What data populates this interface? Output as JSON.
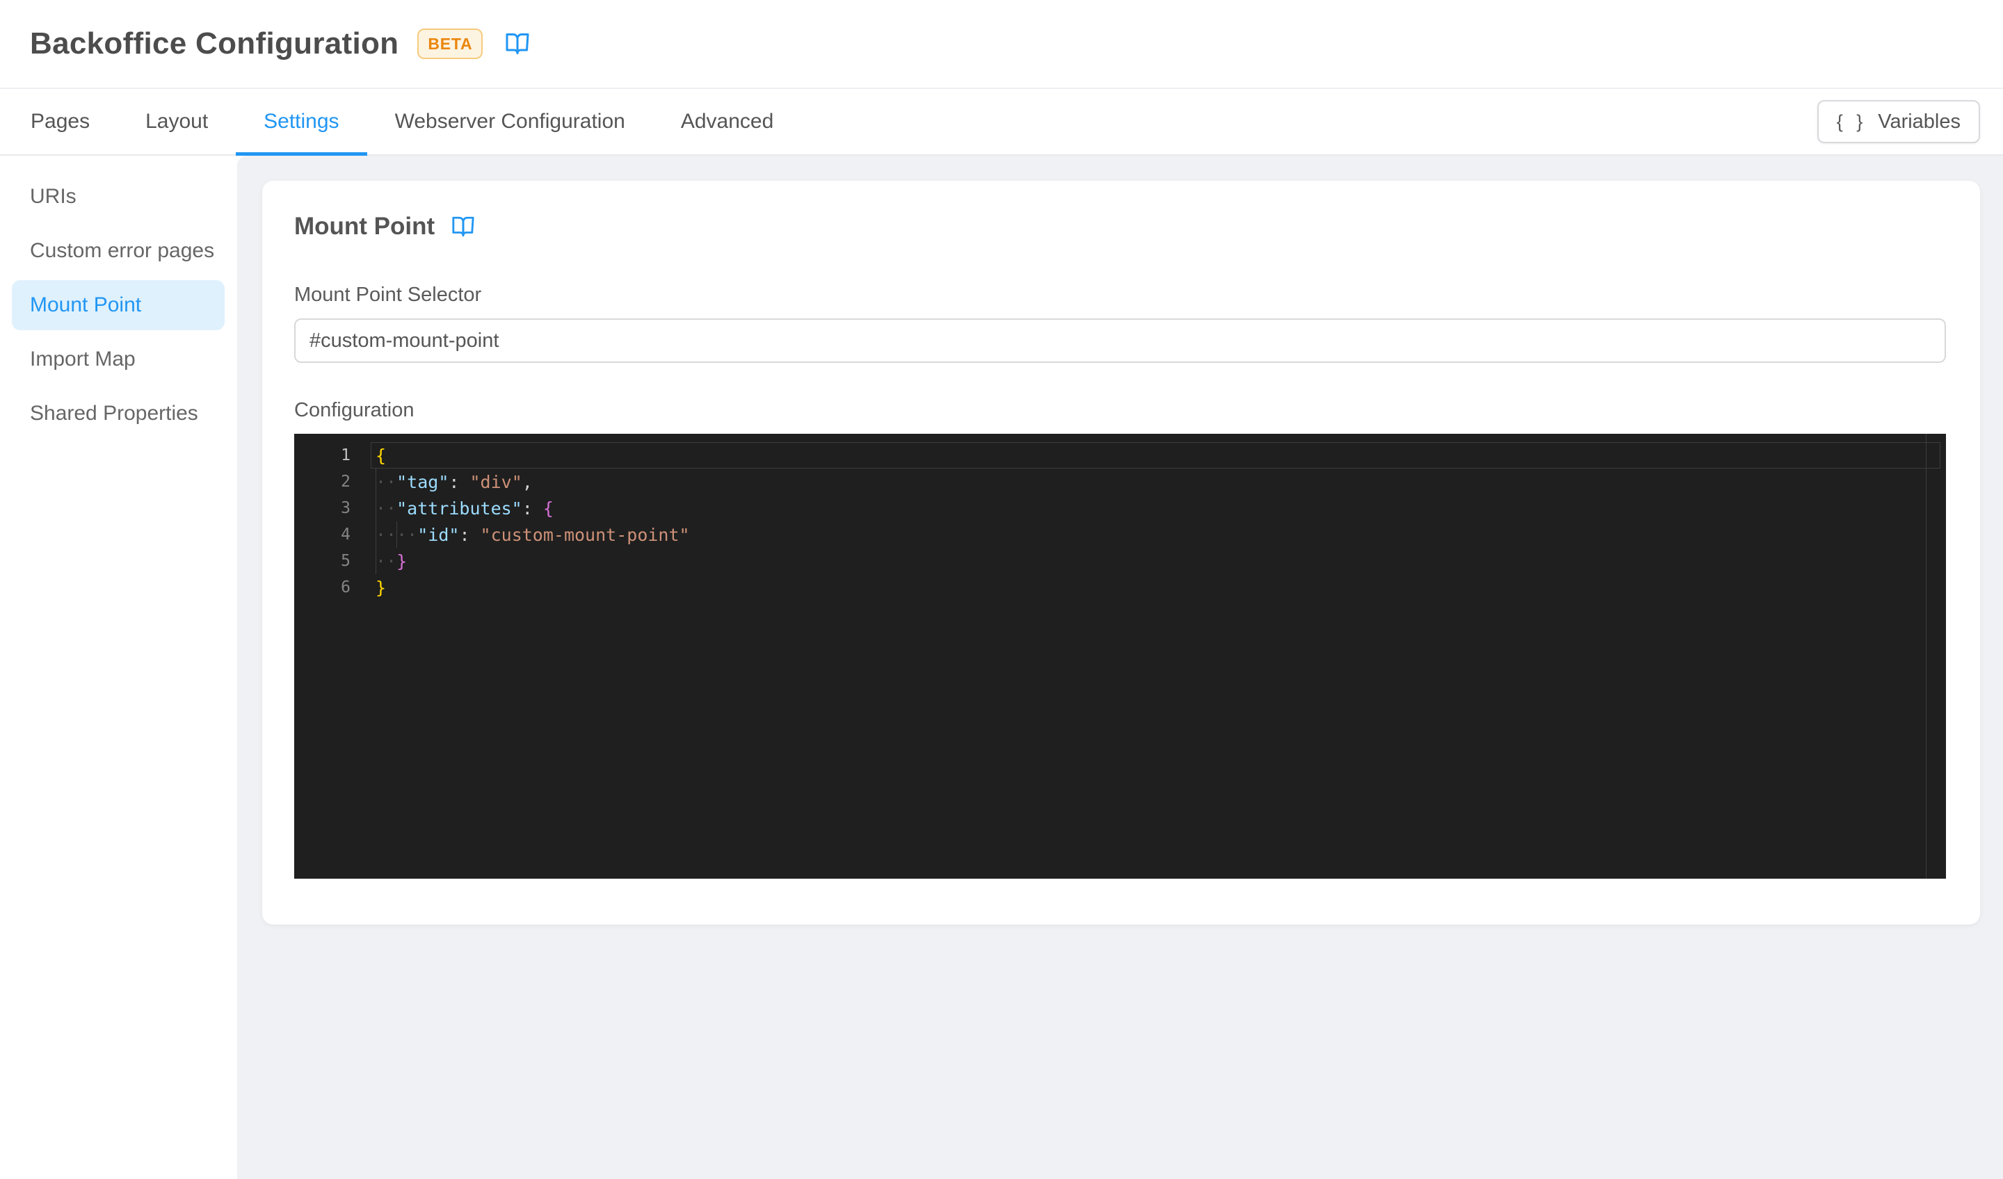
{
  "header": {
    "title": "Backoffice Configuration",
    "badge": "BETA"
  },
  "tabbar": {
    "tabs": [
      {
        "label": "Pages",
        "active": false
      },
      {
        "label": "Layout",
        "active": false
      },
      {
        "label": "Settings",
        "active": true
      },
      {
        "label": "Webserver Configuration",
        "active": false
      },
      {
        "label": "Advanced",
        "active": false
      }
    ],
    "variables_button": {
      "braces": "{ }",
      "label": "Variables"
    }
  },
  "sidebar": {
    "items": [
      {
        "label": "URIs",
        "active": false
      },
      {
        "label": "Custom error pages",
        "active": false
      },
      {
        "label": "Mount Point",
        "active": true
      },
      {
        "label": "Import Map",
        "active": false
      },
      {
        "label": "Shared Properties",
        "active": false
      }
    ]
  },
  "content": {
    "section_title": "Mount Point",
    "selector_field": {
      "label": "Mount Point Selector",
      "value": "#custom-mount-point"
    },
    "configuration": {
      "label": "Configuration",
      "code_lines": [
        {
          "number": "1",
          "current": true,
          "tokens": [
            {
              "type": "bracket1",
              "text": "{"
            }
          ]
        },
        {
          "number": "2",
          "current": false,
          "tokens": [
            {
              "type": "whitespace",
              "text": "··"
            },
            {
              "type": "key",
              "text": "\"tag\""
            },
            {
              "type": "punct",
              "text": ": "
            },
            {
              "type": "string",
              "text": "\"div\""
            },
            {
              "type": "punct",
              "text": ","
            }
          ]
        },
        {
          "number": "3",
          "current": false,
          "tokens": [
            {
              "type": "whitespace",
              "text": "··"
            },
            {
              "type": "key",
              "text": "\"attributes\""
            },
            {
              "type": "punct",
              "text": ": "
            },
            {
              "type": "bracket2",
              "text": "{"
            }
          ]
        },
        {
          "number": "4",
          "current": false,
          "tokens": [
            {
              "type": "whitespace",
              "text": "····"
            },
            {
              "type": "key",
              "text": "\"id\""
            },
            {
              "type": "punct",
              "text": ": "
            },
            {
              "type": "string",
              "text": "\"custom-mount-point\""
            }
          ]
        },
        {
          "number": "5",
          "current": false,
          "tokens": [
            {
              "type": "whitespace",
              "text": "··"
            },
            {
              "type": "bracket2",
              "text": "}"
            }
          ]
        },
        {
          "number": "6",
          "current": false,
          "tokens": [
            {
              "type": "bracket1",
              "text": "}"
            }
          ]
        }
      ]
    }
  },
  "colors": {
    "accent": "#2196f3",
    "beta_fg": "#ea860d",
    "beta_bg": "#fdf3e1",
    "beta_border": "#f6ca7e",
    "sidebar_pill_bg": "#dff1fd",
    "editor": {
      "bg": "#1f1f1f",
      "gutter": "#858585",
      "gutter_active": "#c2c2c2",
      "key": "#9cdcfe",
      "string": "#ce9178",
      "punct": "#d4d4d4",
      "bracket1": "#ffd700",
      "bracket2": "#d670d6",
      "whitespace": "#4e4e4e",
      "indent_guide": "#3f3f3f",
      "current_line_border": "#3c3c3c",
      "divider": "#3d3d3d"
    }
  }
}
